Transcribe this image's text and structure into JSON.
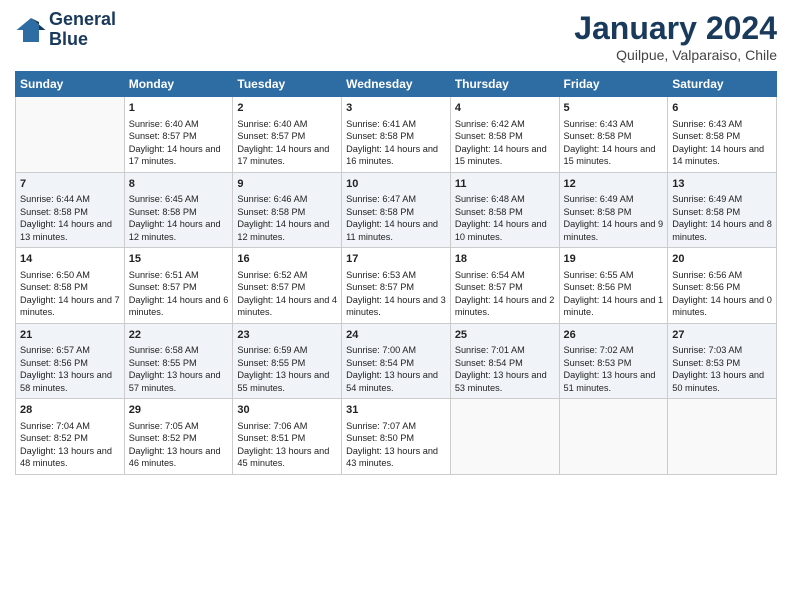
{
  "logo": {
    "line1": "General",
    "line2": "Blue"
  },
  "title": "January 2024",
  "subtitle": "Quilpue, Valparaiso, Chile",
  "days_of_week": [
    "Sunday",
    "Monday",
    "Tuesday",
    "Wednesday",
    "Thursday",
    "Friday",
    "Saturday"
  ],
  "weeks": [
    [
      {
        "day": "",
        "sunrise": "",
        "sunset": "",
        "daylight": ""
      },
      {
        "day": "1",
        "sunrise": "Sunrise: 6:40 AM",
        "sunset": "Sunset: 8:57 PM",
        "daylight": "Daylight: 14 hours and 17 minutes."
      },
      {
        "day": "2",
        "sunrise": "Sunrise: 6:40 AM",
        "sunset": "Sunset: 8:57 PM",
        "daylight": "Daylight: 14 hours and 17 minutes."
      },
      {
        "day": "3",
        "sunrise": "Sunrise: 6:41 AM",
        "sunset": "Sunset: 8:58 PM",
        "daylight": "Daylight: 14 hours and 16 minutes."
      },
      {
        "day": "4",
        "sunrise": "Sunrise: 6:42 AM",
        "sunset": "Sunset: 8:58 PM",
        "daylight": "Daylight: 14 hours and 15 minutes."
      },
      {
        "day": "5",
        "sunrise": "Sunrise: 6:43 AM",
        "sunset": "Sunset: 8:58 PM",
        "daylight": "Daylight: 14 hours and 15 minutes."
      },
      {
        "day": "6",
        "sunrise": "Sunrise: 6:43 AM",
        "sunset": "Sunset: 8:58 PM",
        "daylight": "Daylight: 14 hours and 14 minutes."
      }
    ],
    [
      {
        "day": "7",
        "sunrise": "Sunrise: 6:44 AM",
        "sunset": "Sunset: 8:58 PM",
        "daylight": "Daylight: 14 hours and 13 minutes."
      },
      {
        "day": "8",
        "sunrise": "Sunrise: 6:45 AM",
        "sunset": "Sunset: 8:58 PM",
        "daylight": "Daylight: 14 hours and 12 minutes."
      },
      {
        "day": "9",
        "sunrise": "Sunrise: 6:46 AM",
        "sunset": "Sunset: 8:58 PM",
        "daylight": "Daylight: 14 hours and 12 minutes."
      },
      {
        "day": "10",
        "sunrise": "Sunrise: 6:47 AM",
        "sunset": "Sunset: 8:58 PM",
        "daylight": "Daylight: 14 hours and 11 minutes."
      },
      {
        "day": "11",
        "sunrise": "Sunrise: 6:48 AM",
        "sunset": "Sunset: 8:58 PM",
        "daylight": "Daylight: 14 hours and 10 minutes."
      },
      {
        "day": "12",
        "sunrise": "Sunrise: 6:49 AM",
        "sunset": "Sunset: 8:58 PM",
        "daylight": "Daylight: 14 hours and 9 minutes."
      },
      {
        "day": "13",
        "sunrise": "Sunrise: 6:49 AM",
        "sunset": "Sunset: 8:58 PM",
        "daylight": "Daylight: 14 hours and 8 minutes."
      }
    ],
    [
      {
        "day": "14",
        "sunrise": "Sunrise: 6:50 AM",
        "sunset": "Sunset: 8:58 PM",
        "daylight": "Daylight: 14 hours and 7 minutes."
      },
      {
        "day": "15",
        "sunrise": "Sunrise: 6:51 AM",
        "sunset": "Sunset: 8:57 PM",
        "daylight": "Daylight: 14 hours and 6 minutes."
      },
      {
        "day": "16",
        "sunrise": "Sunrise: 6:52 AM",
        "sunset": "Sunset: 8:57 PM",
        "daylight": "Daylight: 14 hours and 4 minutes."
      },
      {
        "day": "17",
        "sunrise": "Sunrise: 6:53 AM",
        "sunset": "Sunset: 8:57 PM",
        "daylight": "Daylight: 14 hours and 3 minutes."
      },
      {
        "day": "18",
        "sunrise": "Sunrise: 6:54 AM",
        "sunset": "Sunset: 8:57 PM",
        "daylight": "Daylight: 14 hours and 2 minutes."
      },
      {
        "day": "19",
        "sunrise": "Sunrise: 6:55 AM",
        "sunset": "Sunset: 8:56 PM",
        "daylight": "Daylight: 14 hours and 1 minute."
      },
      {
        "day": "20",
        "sunrise": "Sunrise: 6:56 AM",
        "sunset": "Sunset: 8:56 PM",
        "daylight": "Daylight: 14 hours and 0 minutes."
      }
    ],
    [
      {
        "day": "21",
        "sunrise": "Sunrise: 6:57 AM",
        "sunset": "Sunset: 8:56 PM",
        "daylight": "Daylight: 13 hours and 58 minutes."
      },
      {
        "day": "22",
        "sunrise": "Sunrise: 6:58 AM",
        "sunset": "Sunset: 8:55 PM",
        "daylight": "Daylight: 13 hours and 57 minutes."
      },
      {
        "day": "23",
        "sunrise": "Sunrise: 6:59 AM",
        "sunset": "Sunset: 8:55 PM",
        "daylight": "Daylight: 13 hours and 55 minutes."
      },
      {
        "day": "24",
        "sunrise": "Sunrise: 7:00 AM",
        "sunset": "Sunset: 8:54 PM",
        "daylight": "Daylight: 13 hours and 54 minutes."
      },
      {
        "day": "25",
        "sunrise": "Sunrise: 7:01 AM",
        "sunset": "Sunset: 8:54 PM",
        "daylight": "Daylight: 13 hours and 53 minutes."
      },
      {
        "day": "26",
        "sunrise": "Sunrise: 7:02 AM",
        "sunset": "Sunset: 8:53 PM",
        "daylight": "Daylight: 13 hours and 51 minutes."
      },
      {
        "day": "27",
        "sunrise": "Sunrise: 7:03 AM",
        "sunset": "Sunset: 8:53 PM",
        "daylight": "Daylight: 13 hours and 50 minutes."
      }
    ],
    [
      {
        "day": "28",
        "sunrise": "Sunrise: 7:04 AM",
        "sunset": "Sunset: 8:52 PM",
        "daylight": "Daylight: 13 hours and 48 minutes."
      },
      {
        "day": "29",
        "sunrise": "Sunrise: 7:05 AM",
        "sunset": "Sunset: 8:52 PM",
        "daylight": "Daylight: 13 hours and 46 minutes."
      },
      {
        "day": "30",
        "sunrise": "Sunrise: 7:06 AM",
        "sunset": "Sunset: 8:51 PM",
        "daylight": "Daylight: 13 hours and 45 minutes."
      },
      {
        "day": "31",
        "sunrise": "Sunrise: 7:07 AM",
        "sunset": "Sunset: 8:50 PM",
        "daylight": "Daylight: 13 hours and 43 minutes."
      },
      {
        "day": "",
        "sunrise": "",
        "sunset": "",
        "daylight": ""
      },
      {
        "day": "",
        "sunrise": "",
        "sunset": "",
        "daylight": ""
      },
      {
        "day": "",
        "sunrise": "",
        "sunset": "",
        "daylight": ""
      }
    ]
  ]
}
